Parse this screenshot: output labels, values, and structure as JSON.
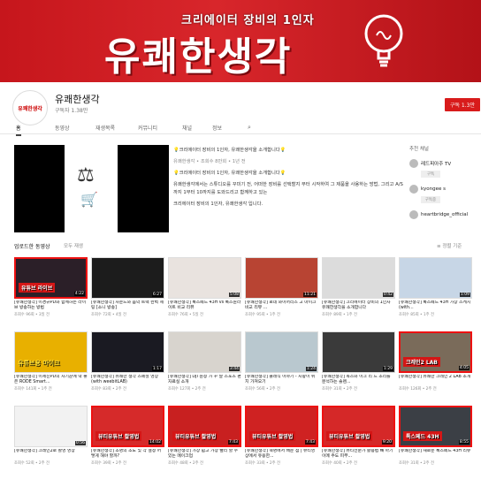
{
  "banner": {
    "subtitle": "크리에이터 장비의 1인자",
    "title": "유쾌한생각"
  },
  "channel": {
    "avatar_text": "유쾌한생각",
    "name": "유쾌한생각",
    "subscribers": "구독자 1.38만",
    "subscribe_label": "구독 1.3만"
  },
  "tabs": [
    "홈",
    "동영상",
    "재생목록",
    "커뮤니티",
    "채널",
    "정보"
  ],
  "featured": {
    "description": [
      "💡크리에이터 장비의 1인자, 유쾌한생각을 소개합니다💡",
      "유쾌한생각 • 조회수 8만회 • 1년 전",
      "💡크리에이터 장비의 1인자, 유쾌한생각을 소개합니다💡",
      "유쾌한생각에서는 스튜디오를 꾸미기 전, 어떠한 장비를 선택할지 부터 시작하여 그 제품을 사용하는 방법, 그리고 A/S까지 1부터 10까지를 도와드리고 함께하고 있는",
      "크리에이터 장비의 1인자, 유쾌한생각 입니다."
    ]
  },
  "sidebar": {
    "title": "추천 채널",
    "channels": [
      {
        "name": "레드피아주 TV",
        "button": "구독"
      },
      {
        "name": "kyongee s",
        "button": "구독중"
      },
      {
        "name": "heartbridge_official",
        "button": ""
      }
    ]
  },
  "uploads": {
    "title": "업로드한 동영상",
    "play_all": "모두 재생",
    "sort": "정렬 기준"
  },
  "videos": [
    {
      "title": "[유쾌한생각] 이경규PD와 함께하는 라이브 방송하는 방법",
      "meta": "조회수 96회 • 3일 전",
      "dur": "4:22",
      "tag": "유튜브 라이브",
      "tagcls": "red"
    },
    {
      "title": "[유쾌한생각] 사운드와 음악 트랙 완벽 세팅 [소니 방송]",
      "meta": "조회수 72회 • 4일 전",
      "dur": "6:27",
      "tag": "",
      "tagcls": ""
    },
    {
      "title": "[유쾌한생각] 톡스페드 43H vs 톡스원라이트 비교 리뷰",
      "meta": "조회수 76회 • 5일 전",
      "dur": "5:08",
      "tag": "",
      "tagcls": ""
    },
    {
      "title": "[유쾌한생각] 로데 와이어리스 고 마이크 비교 리뷰 ...",
      "meta": "조회수 95회 • 1주 전",
      "dur": "11:21",
      "tag": "",
      "tagcls": ""
    },
    {
      "title": "[유쾌한생각] 크리에이터 장비의 1인자 유쾌한생각을 소개합니다",
      "meta": "조회수 89회 • 1주 전",
      "dur": "0:42",
      "tag": "",
      "tagcls": ""
    },
    {
      "title": "[유쾌한생각] 톡스페드 43H 가장 스케치 (with...",
      "meta": "조회수 85회 • 1주 전",
      "dur": "1:09",
      "tag": "",
      "tagcls": ""
    },
    {
      "title": "[유쾌한생각] 이세진PD의 사기꾼에 딱 좋은 RODE Smart...",
      "meta": "조회수 141회 • 1주 전",
      "dur": "",
      "tag": "유튜브용 마이크",
      "tagcls": "yel"
    },
    {
      "title": "[유쾌한생각] 유쾌한 생각 스페셜 영상 (with weebitLAB)",
      "meta": "조회수 83회 • 2주 전",
      "dur": "1:17",
      "tag": "",
      "tagcls": ""
    },
    {
      "title": "[유쾌한생각] DJI 원정 가 꾸 달 스포츠 편 자료실 소개",
      "meta": "조회수 127회 • 2주 전",
      "dur": "3:44",
      "tag": "",
      "tagcls": ""
    },
    {
      "title": "[유쾌한생각] 클래식 이야기 - 지팡이 위치 가져오기",
      "meta": "조회수 56회 • 2주 전",
      "dur": "1:24",
      "tag": "",
      "tagcls": ""
    },
    {
      "title": "[유쾌한생각] 녹스와 이크 리 드 소리를 분석하는 솔렌...",
      "meta": "조회수 31회 • 2주 전",
      "dur": "1:29",
      "tag": "",
      "tagcls": ""
    },
    {
      "title": "[유쾌한생각] 유쾌한 크레인 2 LAB 소개",
      "meta": "조회수 126회 • 2주 전",
      "dur": "4:05",
      "tag": "크레인2 LAB",
      "tagcls": "red"
    },
    {
      "title": "[유쾌한생각] 크레인2로 촬영 영상",
      "meta": "조회수 52회 • 2주 전",
      "dur": "0:56",
      "tag": "",
      "tagcls": ""
    },
    {
      "title": "[유쾌한생각] 조명의 조도 및 각 설정 어떻게 해야 할까?",
      "meta": "조회수 39회 • 2주 전",
      "dur": "14:02",
      "tag": "뷰티유튜브 촬영법",
      "tagcls": "red"
    },
    {
      "title": "[유쾌한생각] 가장 쉽고 가장 빨리 할 수 있는 메이크업",
      "meta": "조회수 48회 • 2주 전",
      "dur": "7:43",
      "tag": "뷰티유튜브 촬영법",
      "tagcls": "red"
    },
    {
      "title": "[유쾌한생각] 혁명에서 배운 점 | 뷰티영상에서 유용한...",
      "meta": "조회수 33회 • 2주 전",
      "dur": "7:43",
      "tag": "뷰티유튜브 촬영법",
      "tagcls": "red"
    },
    {
      "title": "[유쾌한생각] 뷰티전문가 활용법 빼 아기 이메 주도 피부...",
      "meta": "조회수 40회 • 2주 전",
      "dur": "9:20",
      "tag": "뷰티유튜브 촬영법",
      "tagcls": "red"
    },
    {
      "title": "[유쾌한생각] 새로운 톡스페드 43H 리뷰",
      "meta": "조회수 31회 • 2주 전",
      "dur": "8:55",
      "tag": "톡스페드 43H",
      "tagcls": "red"
    }
  ],
  "colors": {
    "brand_red": "#d81b1b",
    "banner_red": "#c6161c"
  }
}
